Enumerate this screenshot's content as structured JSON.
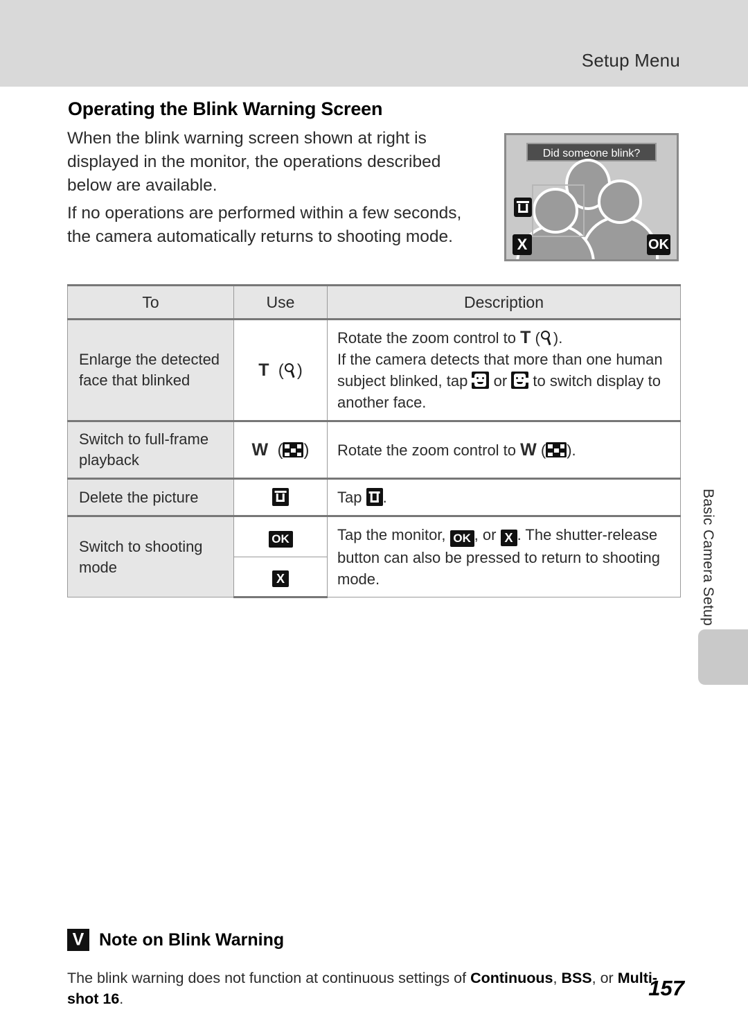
{
  "header": {
    "running_head": "Setup Menu"
  },
  "section": {
    "title": "Operating the Blink Warning Screen",
    "paragraph_1": "When the blink warning screen shown at right is displayed in the monitor, the operations described below are available.",
    "paragraph_2": "If no operations are performed within a few seconds, the camera automatically returns to shooting mode."
  },
  "monitor_illustration": {
    "caption": "Did someone blink?",
    "delete_button_label": "delete",
    "cancel_button_label": "X",
    "confirm_button_label": "OK"
  },
  "table": {
    "headers": {
      "to": "To",
      "use": "Use",
      "description": "Description"
    },
    "rows": [
      {
        "to": "Enlarge the detected face that blinked",
        "use_letter": "T",
        "use_icon": "magnifier-icon",
        "desc_line_1_pre": "Rotate the zoom control to ",
        "desc_line_1_letter": "T",
        "desc_line_1_post": ").",
        "desc_line_2_pre": "If the camera detects that more than one human subject blinked, tap ",
        "desc_line_2_mid": " or ",
        "desc_line_2_post": " to switch display to another face."
      },
      {
        "to": "Switch to full-frame playback",
        "use_letter": "W",
        "use_icon": "thumbnail-grid-icon",
        "desc_pre": "Rotate the zoom control to ",
        "desc_letter": "W",
        "desc_post": ")."
      },
      {
        "to": "Delete the picture",
        "use_icon": "trash-icon",
        "desc_pre": "Tap ",
        "desc_post": "."
      },
      {
        "to": "Switch to shooting mode",
        "use_icon_1": "OK",
        "use_icon_2": "X",
        "desc_pre": "Tap the monitor, ",
        "desc_mid": ", or ",
        "desc_post": ". The shutter-release button can also be pressed to return to shooting mode."
      }
    ]
  },
  "chapter_tab": {
    "label": "Basic Camera Setup"
  },
  "note": {
    "title": "Note on Blink Warning",
    "text_pre": "The blink warning does not function at continuous settings of ",
    "bold_1": "Continuous",
    "sep_1": ", ",
    "bold_2": "BSS",
    "sep_2": ", or ",
    "bold_3": "Multi-shot 16",
    "text_post": "."
  },
  "footer": {
    "page_number": "157"
  }
}
